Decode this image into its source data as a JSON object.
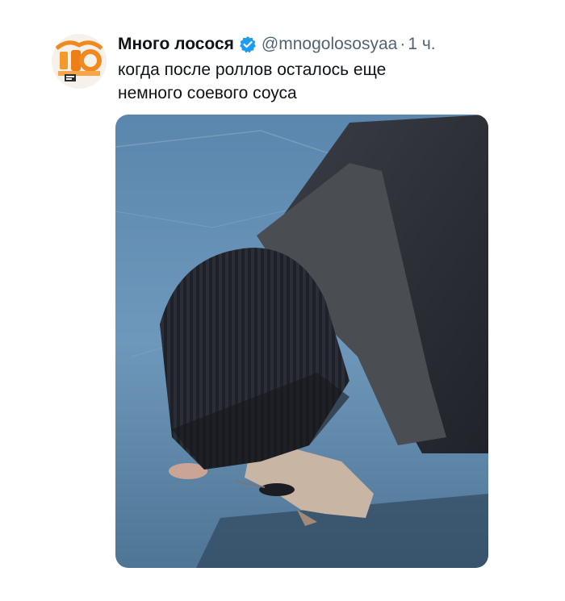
{
  "tweet": {
    "author": {
      "display_name": "Много лосося",
      "handle": "@mnogolososyaa",
      "verified": true,
      "avatar_icon": "salmon-logo-avatar"
    },
    "separator": "·",
    "time": "1 ч.",
    "text_lines": [
      "когда после роллов осталось еще",
      "немного соевого соуса"
    ],
    "media": {
      "type": "photo",
      "icon": "photo-man-licking-ice"
    }
  },
  "colors": {
    "verified_blue": "#1d9bf0",
    "name_text": "#0f1419",
    "secondary_text": "#536471",
    "avatar_orange": "#f08a1e"
  }
}
